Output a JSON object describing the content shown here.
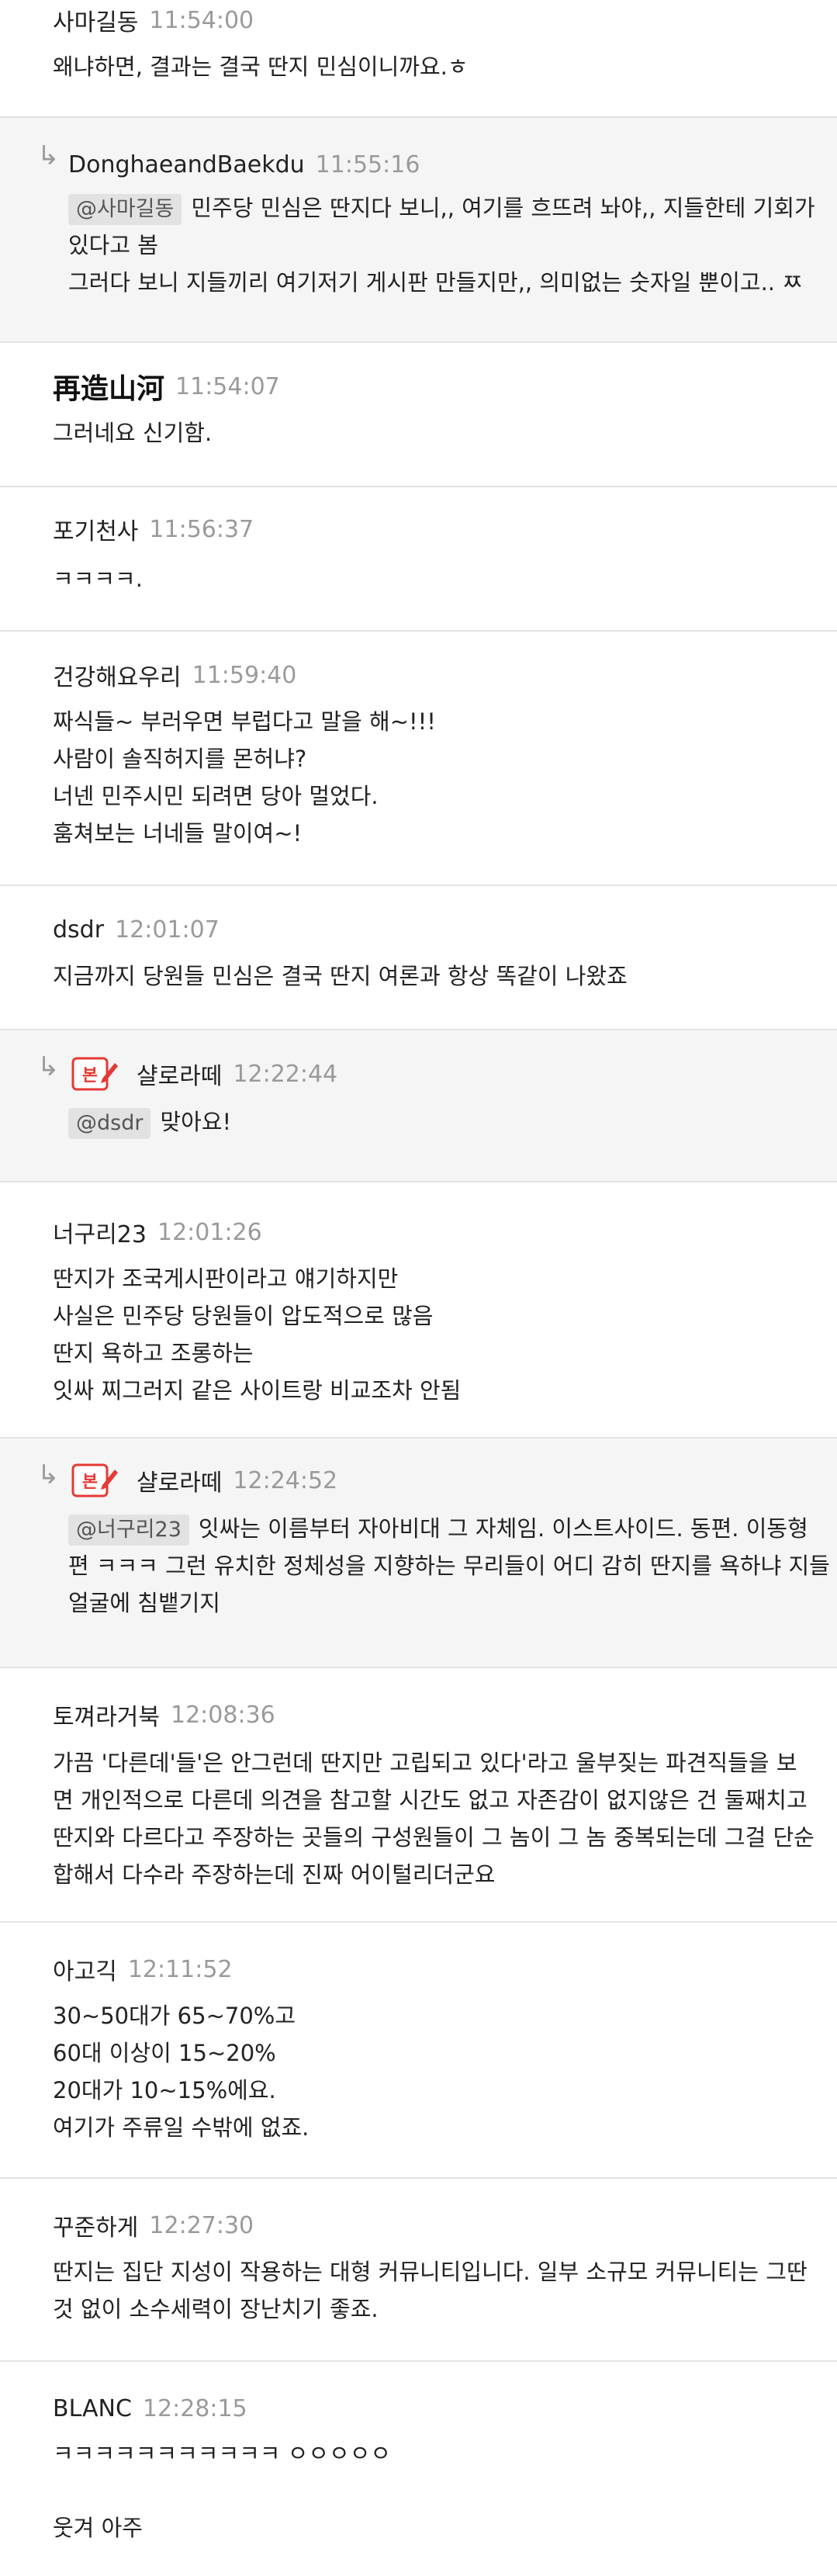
{
  "comments": [
    {
      "author": "사마길동",
      "time": "11:54:00",
      "lines": [
        "왜냐하면, 결과는 결국 딴지 민심이니까요.ㅎ"
      ]
    },
    {
      "author": "DonghaeandBaekdu",
      "time": "11:55:16",
      "mention": "@사마길동",
      "lines": [
        "민주당 민심은 딴지다 보니,, 여기를 흐뜨려 놔야,, 지들한테 기회가",
        "있다고 봄",
        "그러다 보니 지들끼리 여기저기 게시판 만들지만,, 의미없는 숫자일 뿐이고.. ㅉ"
      ]
    },
    {
      "author": "再造山河",
      "time": "11:54:07",
      "lines": [
        "그러네요 신기함."
      ]
    },
    {
      "author": "포기천사",
      "time": "11:56:37",
      "lines": [
        "ㅋㅋㅋㅋ."
      ]
    },
    {
      "author": "건강해요우리",
      "time": "11:59:40",
      "lines": [
        "짜식들~ 부러우면 부럽다고 말을 해~!!!",
        "사람이 솔직허지를 몬허냐?",
        "너넨 민주시민 되려면 당아 멀었다.",
        "훔쳐보는 너네들 말이여~!"
      ]
    },
    {
      "author": "dsdr",
      "time": "12:01:07",
      "lines": [
        "지금까지 당원들 민심은 결국 딴지 여론과 항상 똑같이 나왔죠"
      ]
    },
    {
      "author": "샬로라떼",
      "time": "12:22:44",
      "mention": "@dsdr",
      "lines": [
        "맞아요!"
      ]
    },
    {
      "author": "너구리23",
      "time": "12:01:26",
      "lines": [
        "딴지가 조국게시판이라고 얘기하지만",
        "사실은 민주당 당원들이 압도적으로 많음",
        "딴지 욕하고 조롱하는",
        "잇싸 찌그러지 같은 사이트랑 비교조차 안됨"
      ]
    },
    {
      "author": "샬로라떼",
      "time": "12:24:52",
      "mention": "@너구리23",
      "lines": [
        "잇싸는 이름부터 자아비대 그 자체임. 이스트사이드. 동편. 이동형",
        "편 ㅋㅋㅋ 그런 유치한 정체성을 지향하는 무리들이 어디 감히 딴지를 욕하냐 지들",
        "얼굴에 침뱉기지"
      ]
    },
    {
      "author": "토껴라거북",
      "time": "12:08:36",
      "lines": [
        "가끔 '다른데'들'은 안그런데 딴지만 고립되고 있다'라고 울부짖는 파견직들을 보",
        "면 개인적으로 다른데 의견을 참고할 시간도 없고 자존감이 없지않은 건 둘째치고",
        "딴지와 다르다고 주장하는 곳들의 구성원들이 그 놈이 그 놈 중복되는데 그걸 단순",
        "합해서 다수라 주장하는데 진짜 어이털리더군요"
      ]
    },
    {
      "author": "아고긱",
      "time": "12:11:52",
      "lines": [
        "30~50대가 65~70%고",
        "60대 이상이 15~20%",
        "20대가 10~15%에요.",
        "여기가 주류일 수밖에 없죠."
      ]
    },
    {
      "author": "꾸준하게",
      "time": "12:27:30",
      "lines": [
        "딴지는 집단 지성이 작용하는 대형 커뮤니티입니다. 일부 소규모 커뮤니티는 그딴",
        "것 없이 소수세력이 장난치기 좋죠."
      ]
    },
    {
      "author": "BLANC",
      "time": "12:28:15",
      "lines": [
        "ㅋㅋㅋㅋㅋㅋㅋㅋㅋㅋㅋ ㅇㅇㅇㅇㅇ",
        "",
        "웃겨 아주"
      ]
    }
  ],
  "reply_arrow_icon": "reply-arrow-icon",
  "avatar_icon": "blog-edit-icon",
  "colors": {
    "reply_bg": "#f5f5f5",
    "divider": "#e3e3e3",
    "time": "#9a9a9a",
    "mention_bg": "#e2e2e2",
    "avatar_red": "#e53935"
  }
}
